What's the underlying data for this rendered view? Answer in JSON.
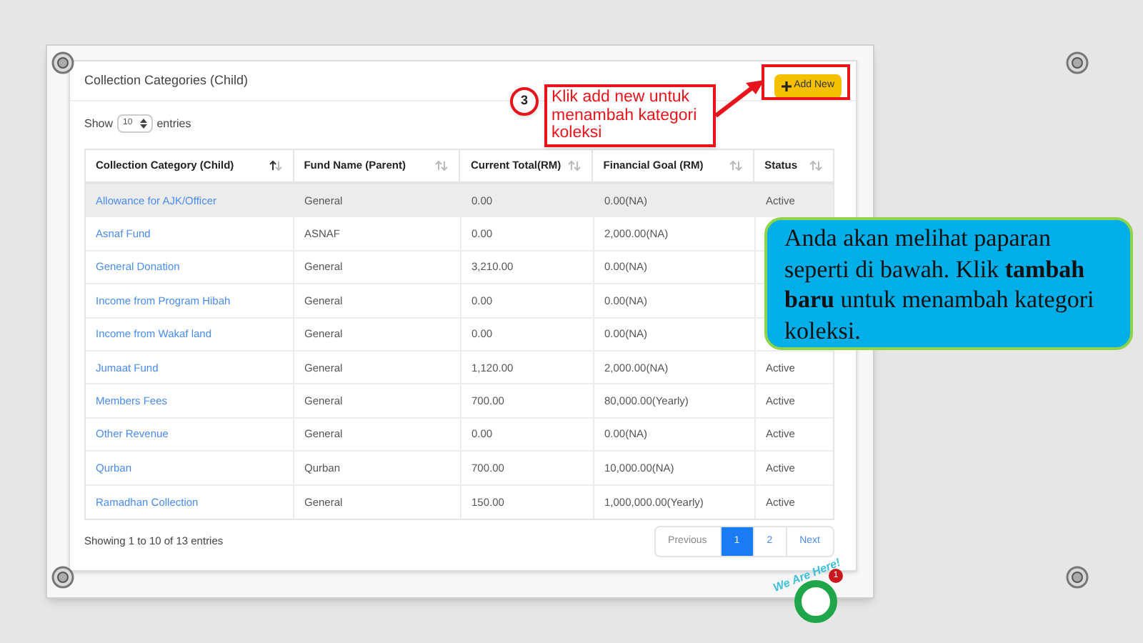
{
  "card": {
    "title": "Collection Categories (Child)",
    "add_button": "Add New"
  },
  "length": {
    "before": "Show",
    "value": "10",
    "after": "entries"
  },
  "table": {
    "columns": [
      {
        "label": "Collection Category (Child)",
        "sorted": true
      },
      {
        "label": "Fund Name (Parent)",
        "sorted": false
      },
      {
        "label": "Current Total(RM)",
        "sorted": false
      },
      {
        "label": "Financial Goal (RM)",
        "sorted": false
      },
      {
        "label": "Status",
        "sorted": false
      }
    ],
    "rows": [
      {
        "name": "Allowance for AJK/Officer",
        "fund": "General",
        "total": "0.00",
        "goal": "0.00(NA)",
        "status": "Active",
        "selected": true
      },
      {
        "name": "Asnaf Fund",
        "fund": "ASNAF",
        "total": "0.00",
        "goal": "2,000.00(NA)",
        "selected": false
      },
      {
        "name": "General Donation",
        "fund": "General",
        "total": "3,210.00",
        "goal": "0.00(NA)",
        "selected": false
      },
      {
        "name": "Income from Program Hibah",
        "fund": "General",
        "total": "0.00",
        "goal": "0.00(NA)",
        "selected": false
      },
      {
        "name": "Income from Wakaf land",
        "fund": "General",
        "total": "0.00",
        "goal": "0.00(NA)",
        "selected": false
      },
      {
        "name": "Jumaat Fund",
        "fund": "General",
        "total": "1,120.00",
        "goal": "2,000.00(NA)",
        "status": "Active",
        "selected": false
      },
      {
        "name": "Members Fees",
        "fund": "General",
        "total": "700.00",
        "goal": "80,000.00(Yearly)",
        "status": "Active",
        "selected": false
      },
      {
        "name": "Other Revenue",
        "fund": "General",
        "total": "0.00",
        "goal": "0.00(NA)",
        "status": "Active",
        "selected": false
      },
      {
        "name": "Qurban",
        "fund": "Qurban",
        "total": "700.00",
        "goal": "10,000.00(NA)",
        "status": "Active",
        "selected": false
      },
      {
        "name": "Ramadhan Collection",
        "fund": "General",
        "total": "150.00",
        "goal": "1,000,000.00(Yearly)",
        "status": "Active",
        "selected": false
      }
    ]
  },
  "info": "Showing 1 to 10 of 13 entries",
  "pagination": [
    {
      "label": "Previous",
      "kind": "prev",
      "selected": false
    },
    {
      "label": "1",
      "kind": "page",
      "selected": true
    },
    {
      "label": "2",
      "kind": "page",
      "selected": false
    },
    {
      "label": "Next",
      "kind": "next",
      "selected": false
    }
  ],
  "step_callout": {
    "number": "3",
    "text": "Klik add new untuk menambah kategori koleksi"
  },
  "note_callout": {
    "text": "Anda akan melihat paparan seperti di bawah. Klik **tambah baru** untuk menambah kategori koleksi."
  },
  "chat_widget": {
    "label": "We Are Here!",
    "badge": "1"
  }
}
